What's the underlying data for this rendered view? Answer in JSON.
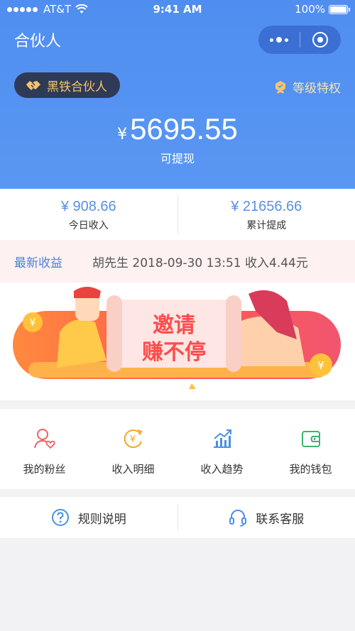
{
  "status_bar": {
    "carrier": "AT&T",
    "time": "9:41 AM",
    "battery": "100%"
  },
  "nav": {
    "title": "合伙人"
  },
  "badge": {
    "label": "黑铁合伙人"
  },
  "privilege": {
    "label": "等级特权"
  },
  "balance": {
    "currency": "¥",
    "amount": "5695.55",
    "caption": "可提现"
  },
  "stats": [
    {
      "value": "¥ 908.66",
      "label": "今日收入"
    },
    {
      "value": "¥ 21656.66",
      "label": "累计提成"
    }
  ],
  "recent": {
    "title": "最新收益",
    "content": "胡先生  2018-09-30 13:51  收入4.44元"
  },
  "banner": {
    "line1": "邀请",
    "line2": "赚不停"
  },
  "menu": [
    {
      "label": "我的粉丝",
      "icon": "fans-icon"
    },
    {
      "label": "收入明细",
      "icon": "income-detail-icon"
    },
    {
      "label": "收入趋势",
      "icon": "trend-chart-icon"
    },
    {
      "label": "我的钱包",
      "icon": "wallet-icon"
    }
  ],
  "help": [
    {
      "label": "规则说明",
      "icon": "question-icon"
    },
    {
      "label": "联系客服",
      "icon": "headset-icon"
    }
  ],
  "colors": {
    "header": "#5a97f3",
    "accent": "#4a82e0",
    "badge_bg": "#2f3a56",
    "badge_text": "#f6c56b"
  }
}
